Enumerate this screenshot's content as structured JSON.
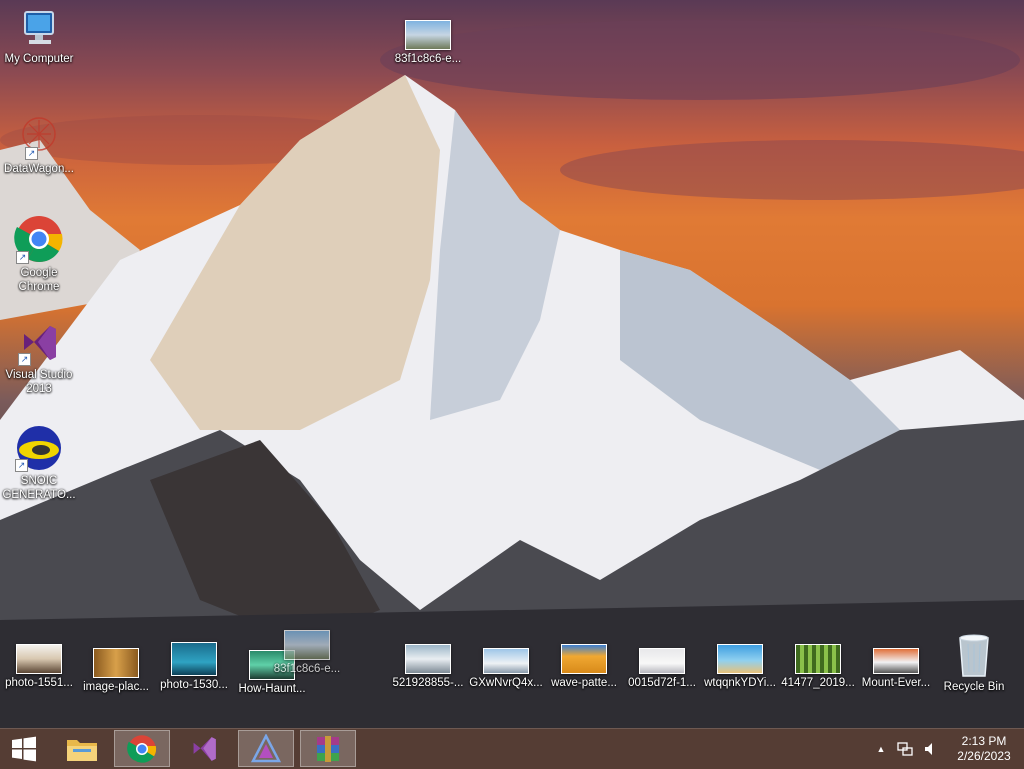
{
  "desktop": {
    "left_icons": [
      {
        "label": "My Computer",
        "icon": "computer-icon"
      },
      {
        "label": "DataWagon...",
        "icon": "datawagon-icon"
      },
      {
        "label": "Google Chrome",
        "icon": "chrome-icon"
      },
      {
        "label": "Visual Studio 2013",
        "icon": "visual-studio-icon"
      },
      {
        "label": "SNOIC GENERATO...",
        "icon": "snoic-icon"
      }
    ],
    "top_icon": {
      "label": "83f1c8c6-e...",
      "icon": "image-file-icon"
    },
    "bottom_icons": [
      {
        "label": "photo-1551...",
        "icon": "image-file-icon"
      },
      {
        "label": "image-plac...",
        "icon": "image-file-icon"
      },
      {
        "label": "photo-1530...",
        "icon": "image-file-icon"
      },
      {
        "label": "How-Haunt...",
        "icon": "image-file-icon"
      },
      {
        "label": "83f1c8c6-e...",
        "icon": "image-file-icon"
      },
      {
        "label": "521928855-...",
        "icon": "image-file-icon"
      },
      {
        "label": "GXwNvrQ4x...",
        "icon": "image-file-icon"
      },
      {
        "label": "wave-patte...",
        "icon": "image-file-icon"
      },
      {
        "label": "0015d72f-1...",
        "icon": "image-file-icon"
      },
      {
        "label": "wtqqnkYDYi...",
        "icon": "image-file-icon"
      },
      {
        "label": "41477_2019...",
        "icon": "image-file-icon"
      },
      {
        "label": "Mount-Ever...",
        "icon": "image-file-icon"
      },
      {
        "label": "Recycle Bin",
        "icon": "recycle-bin-icon"
      }
    ]
  },
  "taskbar": {
    "start": {
      "icon": "windows-start-icon"
    },
    "pinned": [
      {
        "name": "file-explorer",
        "icon": "folder-icon",
        "active": false
      },
      {
        "name": "google-chrome",
        "icon": "chrome-icon",
        "active": true
      },
      {
        "name": "visual-studio",
        "icon": "visual-studio-icon",
        "active": false
      },
      {
        "name": "app-triangle",
        "icon": "triangle-app-icon",
        "active": true
      },
      {
        "name": "winrar",
        "icon": "winrar-icon",
        "active": true
      }
    ],
    "tray": {
      "chevron_glyph": "▲",
      "icons": [
        "network-icon",
        "volume-icon"
      ]
    },
    "clock": {
      "time": "2:13 PM",
      "date": "2/26/2023"
    }
  },
  "colors": {
    "taskbar_bg": "#4a2f25",
    "sky_orange": "#e07a35",
    "vs_purple": "#68217a"
  }
}
